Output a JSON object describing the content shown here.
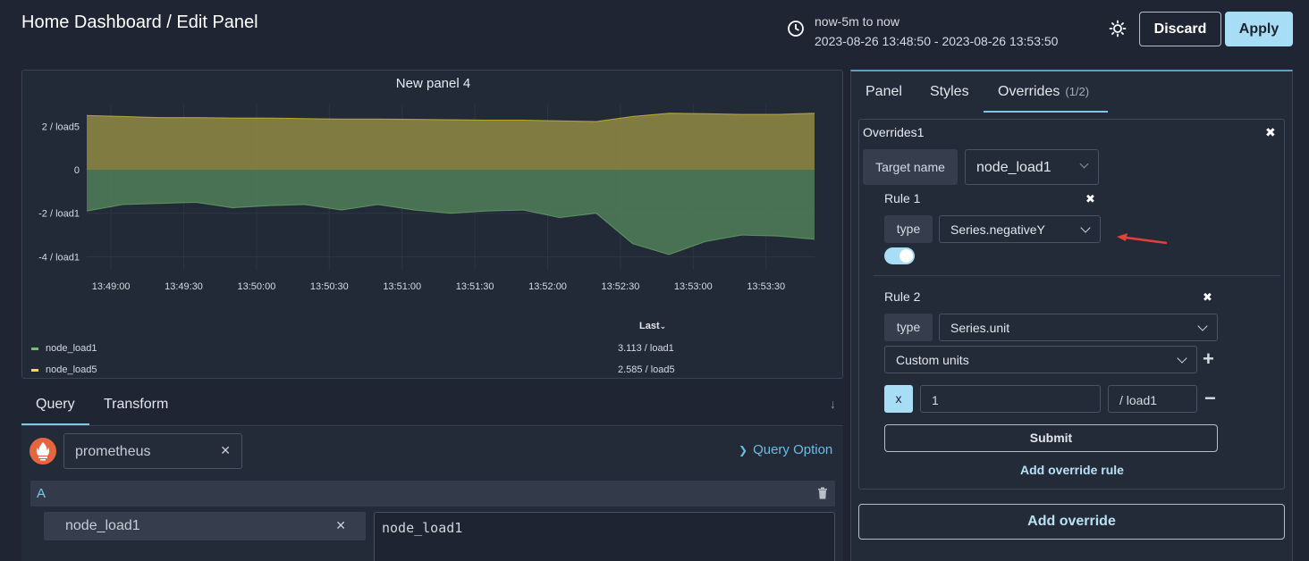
{
  "header": {
    "title": "Home Dashboard / Edit Panel",
    "time_range_label": "now-5m to now",
    "time_range_absolute": "2023-08-26 13:48:50 - 2023-08-26 13:53:50",
    "discard_label": "Discard",
    "apply_label": "Apply",
    "icons": {
      "time": "clock-icon",
      "theme": "sun-icon"
    }
  },
  "panel": {
    "title": "New panel 4",
    "legend": {
      "header": "Last",
      "items": [
        {
          "name": "node_load1",
          "last": "3.113 / load1",
          "color": "#73bf69"
        },
        {
          "name": "node_load5",
          "last": "2.585 / load5",
          "color": "#fade2a"
        }
      ]
    }
  },
  "chart_data": {
    "type": "area",
    "title": "New panel 4",
    "xlabel": "",
    "ylabel": "",
    "x_ticks": [
      "13:49:00",
      "13:49:30",
      "13:50:00",
      "13:50:30",
      "13:51:00",
      "13:51:30",
      "13:52:00",
      "13:52:30",
      "13:53:00",
      "13:53:30"
    ],
    "y_ticks": [
      "2 / load5",
      "0",
      "-2 / load1",
      "-4 / load1"
    ],
    "y_tick_values": [
      2,
      0,
      -2,
      -4
    ],
    "ylim": [
      -4.6,
      3.0
    ],
    "x": [
      "13:48:50",
      "13:49:05",
      "13:49:20",
      "13:49:35",
      "13:49:50",
      "13:50:05",
      "13:50:20",
      "13:50:35",
      "13:50:50",
      "13:51:05",
      "13:51:20",
      "13:51:35",
      "13:51:50",
      "13:52:05",
      "13:52:20",
      "13:52:35",
      "13:52:50",
      "13:53:05",
      "13:53:20",
      "13:53:35",
      "13:53:50"
    ],
    "series": [
      {
        "name": "node_load5",
        "color": "#fade2a",
        "values": [
          2.5,
          2.45,
          2.4,
          2.4,
          2.38,
          2.38,
          2.35,
          2.33,
          2.33,
          2.32,
          2.3,
          2.28,
          2.28,
          2.25,
          2.22,
          2.45,
          2.6,
          2.58,
          2.55,
          2.55,
          2.6
        ]
      },
      {
        "name": "node_load1",
        "color": "#73bf69",
        "values": [
          -1.9,
          -1.6,
          -1.55,
          -1.5,
          -1.75,
          -1.65,
          -1.6,
          -1.85,
          -1.6,
          -1.85,
          -2.0,
          -1.9,
          -1.85,
          -2.2,
          -2.0,
          -3.4,
          -3.9,
          -3.3,
          -3.0,
          -3.05,
          -3.2
        ]
      }
    ],
    "legend_position": "bottom",
    "grid": true
  },
  "query": {
    "tabs": [
      "Query",
      "Transform"
    ],
    "active_tab": "Query",
    "datasource": "prometheus",
    "query_option_label": "Query Option",
    "row_label": "A",
    "metric": "node_load1",
    "expression": "node_load1"
  },
  "options": {
    "tabs": [
      {
        "label": "Panel"
      },
      {
        "label": "Styles"
      },
      {
        "label": "Overrides",
        "count": "(1/2)"
      }
    ],
    "active_tab": "Overrides",
    "override": {
      "title": "Overrides1",
      "target_label": "Target name",
      "target_value": "node_load1",
      "rules": [
        {
          "title": "Rule 1",
          "type_label": "type",
          "type_value": "Series.negativeY",
          "toggle_on": true
        },
        {
          "title": "Rule 2",
          "type_label": "type",
          "type_value": "Series.unit",
          "unit_mode": "Custom units",
          "factor_label": "x",
          "factor_value": "1",
          "suffix_value": "/ load1"
        }
      ],
      "submit_label": "Submit",
      "add_rule_label": "Add override rule"
    },
    "add_override_label": "Add override"
  }
}
